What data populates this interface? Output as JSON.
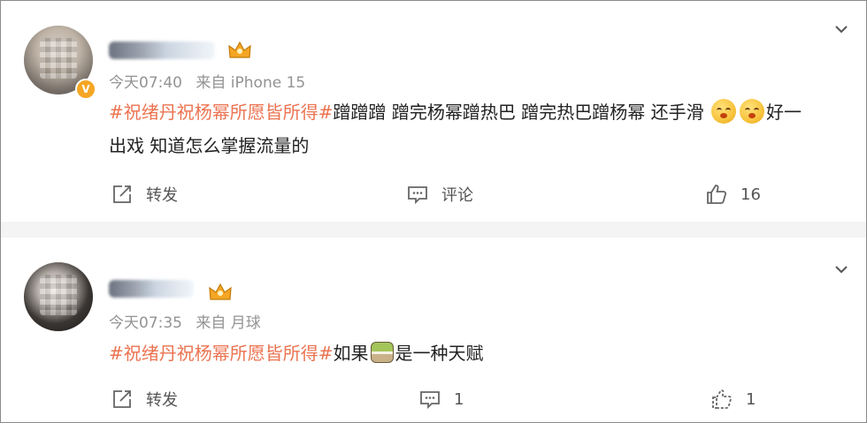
{
  "posts": [
    {
      "time": "今天07:40",
      "source": "来自 iPhone 15",
      "verified_badge": "V",
      "hashtag": "#祝绪丹祝杨幂所愿皆所得#",
      "text_line1": "蹭蹭蹭 蹭完杨幂蹭热巴 蹭完热巴蹭杨幂 还手滑",
      "text_after_emoji": "好一",
      "text_line2": "出戏 知道怎么掌握流量的",
      "emoji": [
        "tongue-face-emoji",
        "tongue-face-emoji"
      ],
      "actions": {
        "repost_label": "转发",
        "comment_label": "评论",
        "like_count": "16"
      }
    },
    {
      "time": "今天07:35",
      "source": "来自 月球",
      "hashtag": "#祝绪丹祝杨幂所愿皆所得#",
      "text_before_emoji": "如果",
      "text_after_emoji": "是一种天赋",
      "emoji": [
        "matcha-cake-emoji"
      ],
      "actions": {
        "repost_label": "转发",
        "comment_count": "1",
        "like_count": "1"
      }
    }
  ],
  "colors": {
    "hashtag": "#eb7350",
    "meta": "#939393",
    "text": "#222222",
    "crown": "#f5a623"
  }
}
